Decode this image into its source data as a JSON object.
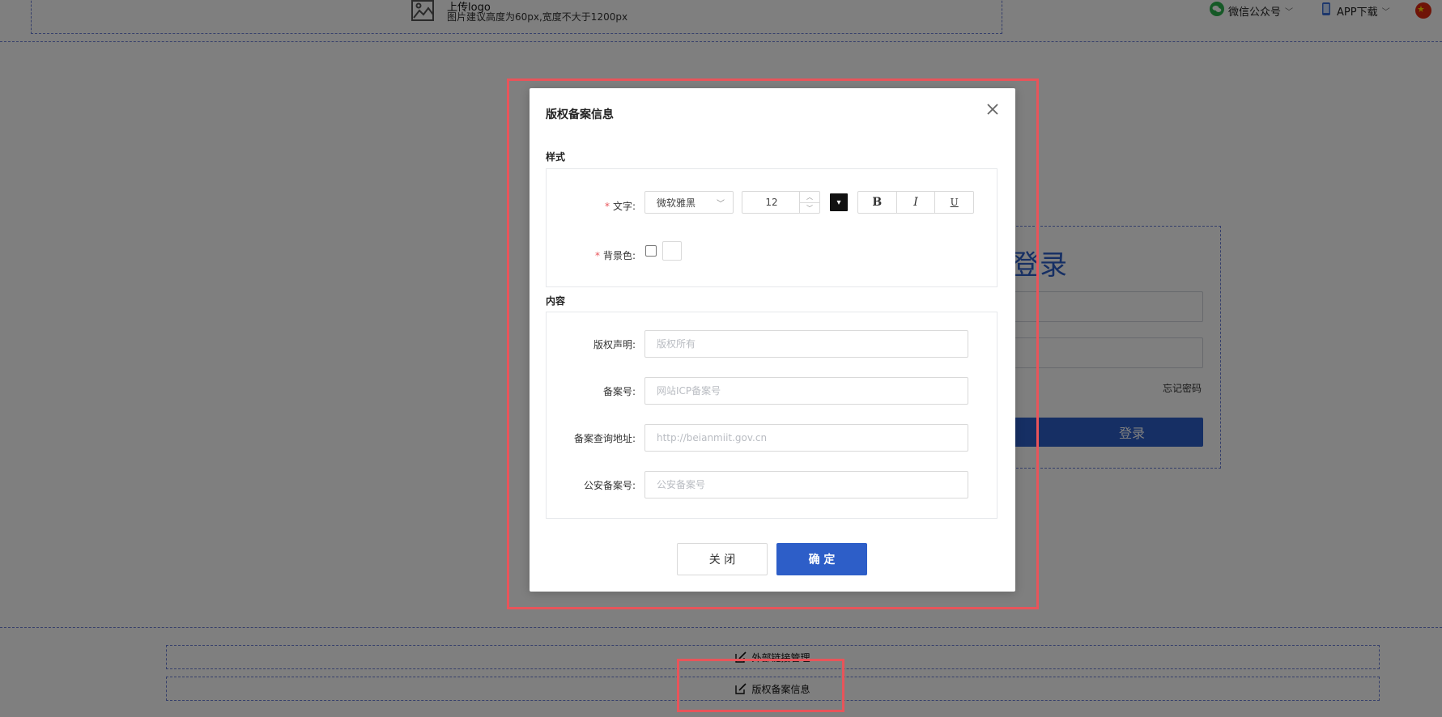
{
  "header": {
    "logo_title": "上传logo",
    "logo_hint": "图片建议高度为60px,宽度不大于1200px",
    "nav": [
      {
        "label": "微信公众号",
        "icon": "wechat-icon"
      },
      {
        "label": "APP下载",
        "icon": "phone-icon"
      }
    ]
  },
  "login": {
    "title": "登录",
    "forgot": "忘记密码",
    "button": "登录"
  },
  "footer": {
    "row1": "外部链接管理",
    "row2": "版权备案信息"
  },
  "modal": {
    "title": "版权备案信息",
    "style_section": "样式",
    "content_section": "内容",
    "text_label": "文字:",
    "font_family": "微软雅黑",
    "font_size": "12",
    "bold": "B",
    "italic": "I",
    "underline": "U",
    "bg_label": "背景色:",
    "fields": [
      {
        "label": "版权声明:",
        "placeholder": "版权所有"
      },
      {
        "label": "备案号:",
        "placeholder": "网站ICP备案号"
      },
      {
        "label": "备案查询地址:",
        "placeholder": "http://beianmiit.gov.cn"
      },
      {
        "label": "公安备案号:",
        "placeholder": "公安备案号"
      }
    ],
    "close_button": "关 闭",
    "ok_button": "确 定"
  },
  "colors": {
    "accent": "#2d5ec8",
    "highlight": "#e8545a",
    "required": "#e8545a"
  }
}
